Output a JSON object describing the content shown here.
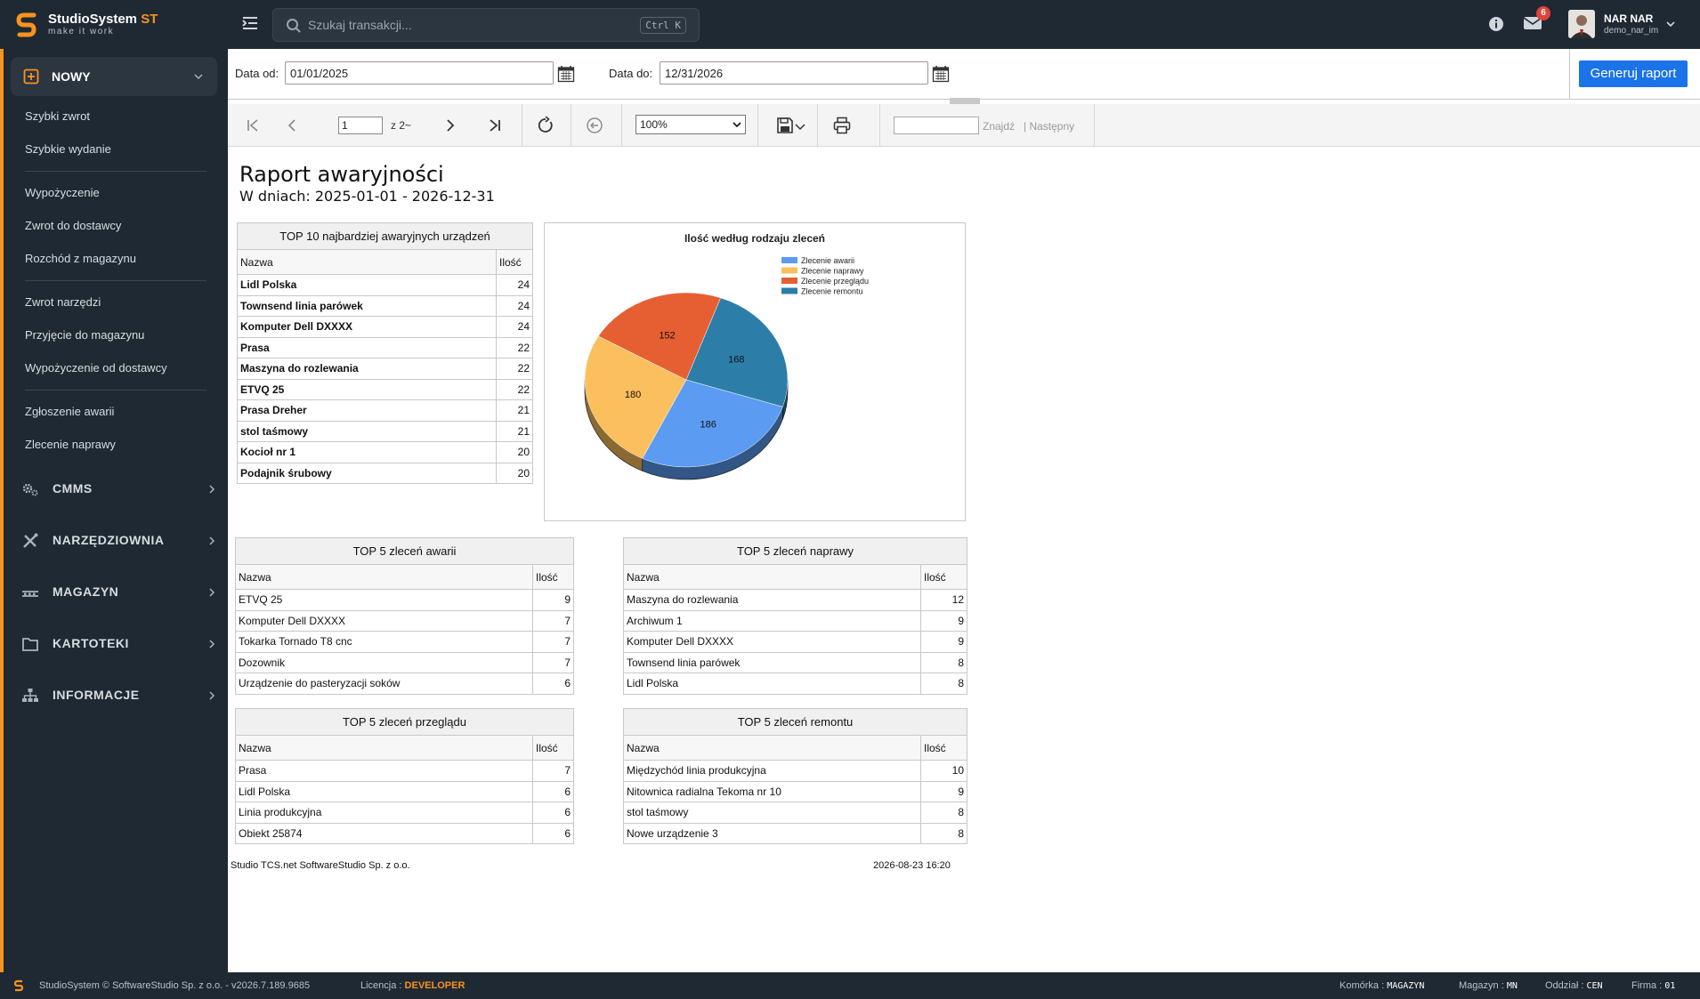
{
  "app": {
    "brand_main": "StudioSystem",
    "brand_suffix": "ST",
    "tagline": "make it work"
  },
  "search": {
    "placeholder": "Szukaj transakcji...",
    "shortcut": "Ctrl K"
  },
  "header": {
    "mail_badge": "6",
    "user_name": "NAR NAR",
    "user_login": "demo_nar_im"
  },
  "sidebar": {
    "active_group": "NOWY",
    "items": [
      "Szybki zwrot",
      "Szybkie wydanie",
      "Wypożyczenie",
      "Zwrot do dostawcy",
      "Rozchód z magazynu",
      "Zwrot narzędzi",
      "Przyjęcie do magazynu",
      "Wypożyczenie od dostawcy",
      "Zgłoszenie awarii",
      "Zlecenie naprawy"
    ],
    "groups": [
      "CMMS",
      "NARZĘDZIOWNIA",
      "MAGAZYN",
      "KARTOTEKI",
      "INFORMACJE"
    ]
  },
  "filters": {
    "date_from_label": "Data od:",
    "date_from": "01/01/2025",
    "date_to_label": "Data do:",
    "date_to": "12/31/2026",
    "generate_label": "Generuj raport"
  },
  "viewer": {
    "page": "1",
    "of_pages": "z 2~",
    "zoom": "100%",
    "find_label": "Znajdź",
    "next_label": "| Następny"
  },
  "report": {
    "title": "Raport awaryjności",
    "subtitle": "W dniach: 2025-01-01 - 2026-12-31",
    "col_name": "Nazwa",
    "col_qty": "Ilość",
    "top10": {
      "caption": "TOP 10 najbardziej awaryjnych urządzeń",
      "rows": [
        [
          "Lidl Polska",
          "24"
        ],
        [
          "Townsend linia parówek",
          "24"
        ],
        [
          "Komputer Dell DXXXX",
          "24"
        ],
        [
          "Prasa",
          "22"
        ],
        [
          "Maszyna do rozlewania",
          "22"
        ],
        [
          "ETVQ 25",
          "22"
        ],
        [
          "Prasa  Dreher",
          "21"
        ],
        [
          "stol taśmowy",
          "21"
        ],
        [
          "Kocioł nr 1",
          "20"
        ],
        [
          "Podajnik śrubowy",
          "20"
        ]
      ]
    },
    "top5_awarii": {
      "caption": "TOP 5 zleceń awarii",
      "rows": [
        [
          "ETVQ 25",
          "9"
        ],
        [
          "Komputer Dell DXXXX",
          "7"
        ],
        [
          "Tokarka Tornado T8 cnc",
          "7"
        ],
        [
          "Dozownik",
          "7"
        ],
        [
          "Urządzenie do pasteryzacji soków",
          "6"
        ]
      ]
    },
    "top5_naprawy": {
      "caption": "TOP 5 zleceń naprawy",
      "rows": [
        [
          "Maszyna do rozlewania",
          "12"
        ],
        [
          "Archiwum 1",
          "9"
        ],
        [
          "Komputer Dell DXXXX",
          "9"
        ],
        [
          "Townsend linia parówek",
          "8"
        ],
        [
          "Lidl Polska",
          "8"
        ]
      ]
    },
    "top5_przegladu": {
      "caption": "TOP 5 zleceń przeglądu",
      "rows": [
        [
          "Prasa",
          "7"
        ],
        [
          "Lidl Polska",
          "6"
        ],
        [
          "Linia produkcyjna",
          "6"
        ],
        [
          "Obiekt 25874",
          "6"
        ]
      ]
    },
    "top5_remontu": {
      "caption": "TOP 5 zleceń remontu",
      "rows": [
        [
          "Międzychód linia produkcyjna",
          "10"
        ],
        [
          "Nitownica radialna Tekoma nr 10",
          "9"
        ],
        [
          "stol taśmowy",
          "8"
        ],
        [
          "Nowe urządzenie 3",
          "8"
        ]
      ]
    },
    "footer_company": "Studio TCS.net SoftwareStudio Sp. z o.o.",
    "footer_date": "2026-08-23 16:20"
  },
  "chart_data": {
    "type": "pie",
    "title": "Ilość według rodzaju zleceń",
    "categories": [
      "Zlecenie awarii",
      "Zlecenie naprawy",
      "Zlecenie przeglądu",
      "Zlecenie remontu"
    ],
    "values": [
      186,
      180,
      152,
      168
    ],
    "colors": [
      "#5b9cf2",
      "#fcbf5d",
      "#e55f33",
      "#2c7ea8"
    ],
    "legend_position": "top-right",
    "three_d": true
  },
  "footer": {
    "copyright": "StudioSystem © SoftwareStudio Sp. z o.o. - v2026.7.189.9685",
    "license_label": "Licencja :",
    "license_value": "DEVELOPER",
    "cell_label": "Komórka :",
    "cell_value": "MAGAZYN",
    "store_label": "Magazyn :",
    "store_value": "MN",
    "branch_label": "Oddział :",
    "branch_value": "CEN",
    "company_label": "Firma :",
    "company_value": "01"
  }
}
